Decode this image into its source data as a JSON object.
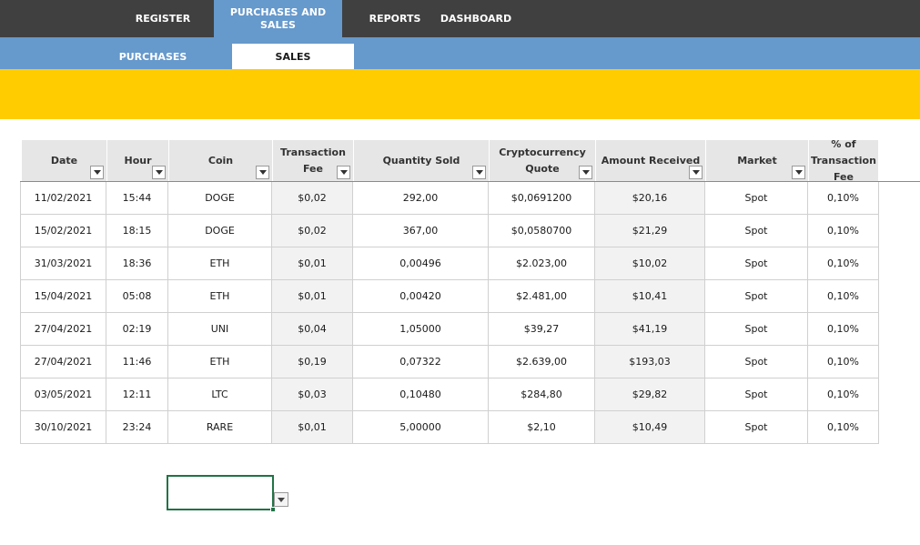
{
  "nav": {
    "items": [
      {
        "label": "REGISTER"
      },
      {
        "label": "PURCHASES AND SALES",
        "line1": "PURCHASES AND",
        "line2": "SALES"
      },
      {
        "label": "REPORTS"
      },
      {
        "label": "DASHBOARD"
      }
    ],
    "active": "PURCHASES AND SALES"
  },
  "subnav": {
    "items": [
      {
        "label": "PURCHASES"
      },
      {
        "label": "SALES"
      }
    ],
    "active": "SALES"
  },
  "table": {
    "columns": [
      {
        "label": "Date"
      },
      {
        "label": "Hour"
      },
      {
        "label": "Coin"
      },
      {
        "label": "Transaction Fee",
        "line1": "Transaction",
        "line2": "Fee"
      },
      {
        "label": "Quantity Sold"
      },
      {
        "label": "Cryptocurrency Quote",
        "line1": "Cryptocurrency",
        "line2": "Quote"
      },
      {
        "label": "Amount Received"
      },
      {
        "label": "Market"
      },
      {
        "label": "% of Transaction Fee",
        "line1": "% of",
        "line2": "Transaction",
        "line3": "Fee"
      }
    ],
    "rows": [
      [
        "11/02/2021",
        "15:44",
        "DOGE",
        "$0,02",
        "292,00",
        "$0,0691200",
        "$20,16",
        "Spot",
        "0,10%"
      ],
      [
        "15/02/2021",
        "18:15",
        "DOGE",
        "$0,02",
        "367,00",
        "$0,0580700",
        "$21,29",
        "Spot",
        "0,10%"
      ],
      [
        "31/03/2021",
        "18:36",
        "ETH",
        "$0,01",
        "0,00496",
        "$2.023,00",
        "$10,02",
        "Spot",
        "0,10%"
      ],
      [
        "15/04/2021",
        "05:08",
        "ETH",
        "$0,01",
        "0,00420",
        "$2.481,00",
        "$10,41",
        "Spot",
        "0,10%"
      ],
      [
        "27/04/2021",
        "02:19",
        "UNI",
        "$0,04",
        "1,05000",
        "$39,27",
        "$41,19",
        "Spot",
        "0,10%"
      ],
      [
        "27/04/2021",
        "11:46",
        "ETH",
        "$0,19",
        "0,07322",
        "$2.639,00",
        "$193,03",
        "Spot",
        "0,10%"
      ],
      [
        "03/05/2021",
        "12:11",
        "LTC",
        "$0,03",
        "0,10480",
        "$284,80",
        "$29,82",
        "Spot",
        "0,10%"
      ],
      [
        "30/10/2021",
        "23:24",
        "RARE",
        "$0,01",
        "5,00000",
        "$2,10",
        "$10,49",
        "Spot",
        "0,10%"
      ]
    ]
  },
  "colors": {
    "topbar": "#404040",
    "accent_blue": "#6699cc",
    "banner_yellow": "#ffcc00",
    "header_gray": "#e6e6e6",
    "selection_green": "#217346"
  },
  "icons": {
    "filter": "chevron-down-icon",
    "dropdown": "chevron-down-icon"
  }
}
